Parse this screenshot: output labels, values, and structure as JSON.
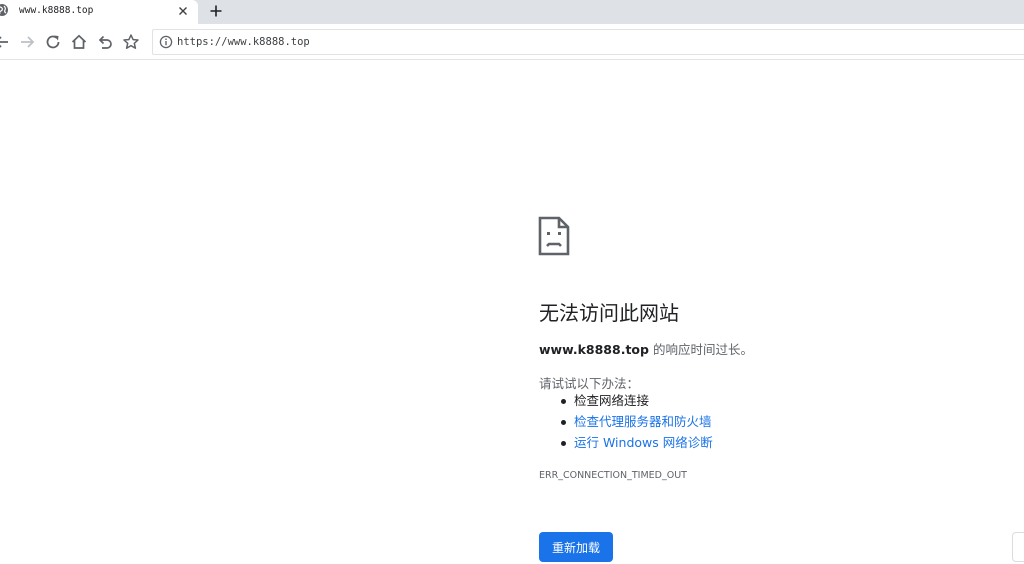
{
  "browser": {
    "tab": {
      "title": "www.k8888.top",
      "favicon": "globe-icon",
      "close_icon": "close-icon"
    },
    "new_tab_icon": "plus-icon",
    "toolbar": {
      "back_icon": "back-arrow-icon",
      "forward_icon": "forward-arrow-icon",
      "reload_icon": "reload-icon",
      "home_icon": "home-icon",
      "undo_icon": "undo-icon",
      "bookmark_icon": "star-icon"
    },
    "address_bar": {
      "security_icon": "info-icon",
      "url": "https://www.k8888.top"
    }
  },
  "error_page": {
    "icon": "sad-page-icon",
    "heading": "无法访问此网站",
    "host": "www.k8888.top",
    "description_suffix": " 的响应时间过长。",
    "try_label": "请试试以下办法：",
    "suggestions": [
      {
        "text": "检查网络连接",
        "is_link": false
      },
      {
        "text": "检查代理服务器和防火墙",
        "is_link": true
      },
      {
        "text": "运行 Windows 网络诊断",
        "is_link": true
      }
    ],
    "error_code": "ERR_CONNECTION_TIMED_OUT",
    "reload_button": "重新加载"
  },
  "colors": {
    "accent": "#1a73e8",
    "tabstrip_bg": "#dee1e6",
    "text_primary": "#202124",
    "text_secondary": "#5f6368"
  }
}
